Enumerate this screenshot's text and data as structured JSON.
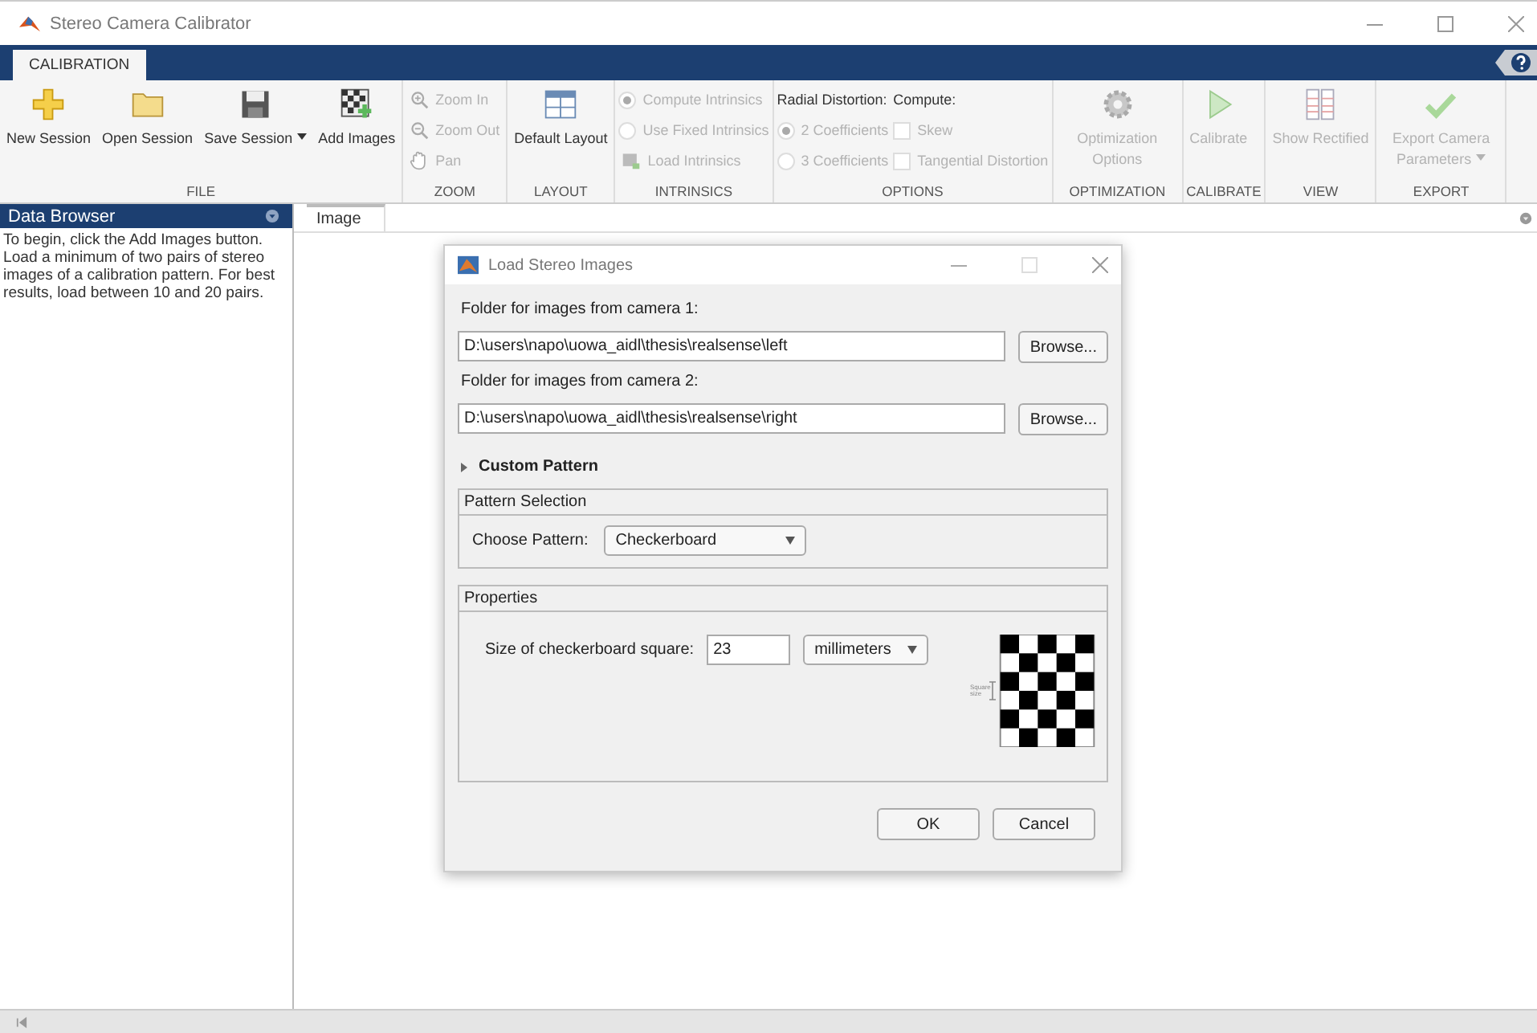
{
  "window": {
    "title": "Stereo Camera Calibrator"
  },
  "ribbon": {
    "tabs": [
      {
        "label": "CALIBRATION",
        "selected": true
      }
    ],
    "groups": [
      {
        "label": "FILE",
        "columns": [
          [
            {
              "kind": "big",
              "label": "New Session",
              "disabled": false
            }
          ],
          [
            {
              "kind": "big",
              "label": "Open Session",
              "disabled": false
            }
          ],
          [
            {
              "kind": "big",
              "label": "Save Session",
              "disabled": false,
              "dropdown": true
            }
          ],
          [
            {
              "kind": "big",
              "label": "Add Images",
              "disabled": false
            }
          ]
        ]
      },
      {
        "label": "ZOOM",
        "columns": [
          [
            {
              "kind": "small",
              "label": "Zoom In",
              "disabled": true
            },
            {
              "kind": "small",
              "label": "Zoom Out",
              "disabled": true
            },
            {
              "kind": "small",
              "label": "Pan",
              "disabled": true
            }
          ]
        ]
      },
      {
        "label": "LAYOUT",
        "columns": [
          [
            {
              "kind": "big",
              "label": "Default Layout",
              "disabled": false
            }
          ]
        ]
      },
      {
        "label": "INTRINSICS",
        "columns": [
          [
            {
              "kind": "radio",
              "label": "Compute Intrinsics",
              "selected": true,
              "disabled": true
            },
            {
              "kind": "radio",
              "label": "Use Fixed Intrinsics",
              "selected": false,
              "disabled": true
            },
            {
              "kind": "small",
              "label": "Load Intrinsics",
              "disabled": true
            }
          ]
        ]
      },
      {
        "label": "OPTIONS",
        "columns": [
          [
            {
              "kind": "heading",
              "label": "Radial Distortion:"
            },
            {
              "kind": "radio",
              "label": "2 Coefficients",
              "selected": true,
              "disabled": true
            },
            {
              "kind": "radio",
              "label": "3 Coefficients",
              "selected": false,
              "disabled": true
            }
          ],
          [
            {
              "kind": "heading",
              "label": "Compute:"
            },
            {
              "kind": "checkbox",
              "label": "Skew",
              "checked": false,
              "disabled": true
            },
            {
              "kind": "checkbox",
              "label": "Tangential Distortion",
              "checked": false,
              "disabled": true
            }
          ]
        ]
      },
      {
        "label": "OPTIMIZATION",
        "columns": [
          [
            {
              "kind": "big",
              "label": "Optimization Options",
              "disabled": true
            }
          ]
        ]
      },
      {
        "label": "CALIBRATE",
        "columns": [
          [
            {
              "kind": "big",
              "label": "Calibrate",
              "disabled": true
            }
          ]
        ]
      },
      {
        "label": "VIEW",
        "columns": [
          [
            {
              "kind": "big",
              "label": "Show Rectified",
              "disabled": true
            }
          ]
        ]
      },
      {
        "label": "EXPORT",
        "columns": [
          [
            {
              "kind": "big",
              "label": "Export Camera Parameters",
              "disabled": true,
              "dropdown": true
            }
          ]
        ]
      }
    ]
  },
  "data_browser": {
    "title": "Data Browser",
    "text": "To begin, click the Add Images button. Load a minimum of two pairs of stereo images of a calibration pattern. For best results, load between 10 and 20 pairs."
  },
  "document_tabs": [
    {
      "label": "Image",
      "selected": true
    }
  ],
  "dialog": {
    "title": "Load Stereo Images",
    "folders": [
      {
        "label": "Folder for images from camera 1:",
        "value": "D:\\users\\napo\\uowa_aidl\\thesis\\realsense\\left",
        "button": "Browse..."
      },
      {
        "label": "Folder for images from camera 2:",
        "value": "D:\\users\\napo\\uowa_aidl\\thesis\\realsense\\right",
        "button": "Browse..."
      }
    ],
    "custom_pattern": {
      "label": "Custom Pattern",
      "expanded": false
    },
    "pattern_selection": {
      "title": "Pattern Selection",
      "label": "Choose Pattern:",
      "value": "Checkerboard"
    },
    "properties": {
      "title": "Properties",
      "label": "Size of checkerboard square:",
      "value": "23",
      "units": "millimeters",
      "diagram_label": "Square size"
    },
    "buttons": [
      "OK",
      "Cancel"
    ]
  }
}
